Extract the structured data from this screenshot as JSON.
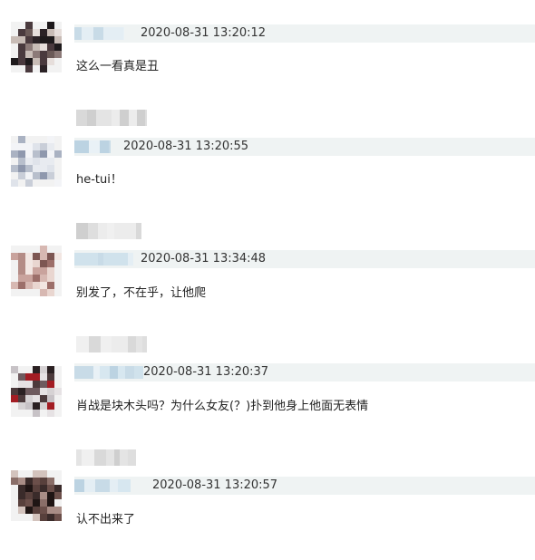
{
  "comments": [
    {
      "username": "",
      "timestamp": "2020-08-31 13:20:12",
      "text": "这么一看真是丑"
    },
    {
      "username": "",
      "timestamp": "2020-08-31 13:20:55",
      "text": "he-tui！"
    },
    {
      "username": "",
      "timestamp": "2020-08-31 13:34:48",
      "text": "别发了，不在乎，让他爬"
    },
    {
      "username": "",
      "timestamp": "2020-08-31 13:20:37",
      "text": "肖战是块木头吗？为什么女友(？)扑到他身上他面无表情"
    },
    {
      "username": "",
      "timestamp": "2020-08-31 13:20:57",
      "text": "认不出来了"
    }
  ],
  "colors": {
    "header_bg": "#eff3f3",
    "text": "#222222",
    "timestamp": "#333333",
    "page_bg": "#ffffff"
  }
}
